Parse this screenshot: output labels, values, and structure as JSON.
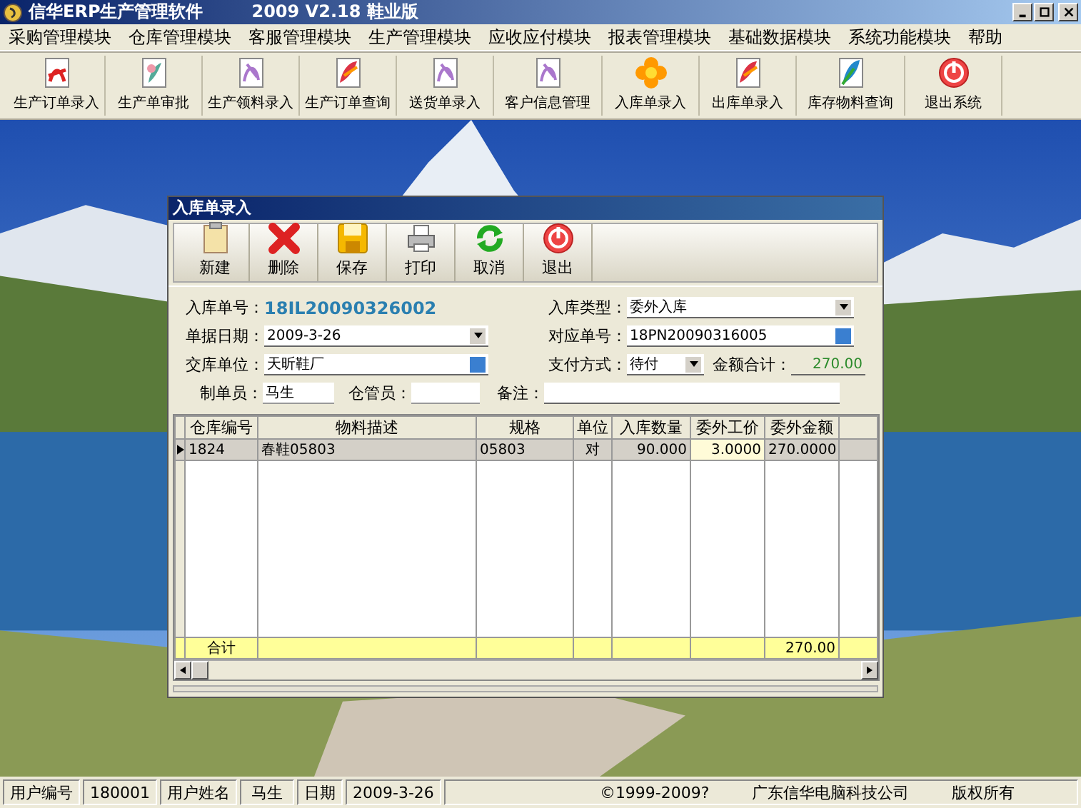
{
  "window": {
    "title": "信华ERP生产管理软件",
    "version": "2009 V2.18 鞋业版"
  },
  "menu": [
    "采购管理模块",
    "仓库管理模块",
    "客服管理模块",
    "生产管理模块",
    "应收应付模块",
    "报表管理模块",
    "基础数据模块",
    "系统功能模块",
    "帮助"
  ],
  "toolbar": [
    {
      "label": "生产订单录入"
    },
    {
      "label": "生产单审批"
    },
    {
      "label": "生产领料录入"
    },
    {
      "label": "生产订单查询"
    },
    {
      "label": "送货单录入"
    },
    {
      "label": "客户信息管理"
    },
    {
      "label": "入库单录入"
    },
    {
      "label": "出库单录入"
    },
    {
      "label": "库存物料查询"
    },
    {
      "label": "退出系统"
    }
  ],
  "dialog": {
    "title": "入库单录入",
    "toolbar": [
      {
        "label": "新建"
      },
      {
        "label": "删除"
      },
      {
        "label": "保存"
      },
      {
        "label": "打印"
      },
      {
        "label": "取消"
      },
      {
        "label": "退出"
      }
    ],
    "form_rows": [
      [
        {
          "label": "入库单号：",
          "value": "18IL20090326002",
          "kind": "code"
        },
        {
          "label": "入库类型：",
          "value": "委外入库",
          "kind": "dropdown"
        }
      ],
      [
        {
          "label": "单据日期：",
          "value": "2009-3-26",
          "kind": "dropdown"
        },
        {
          "label": "对应单号：",
          "value": "18PN20090316005",
          "kind": "lookup"
        }
      ],
      [
        {
          "label": "交库单位：",
          "value": "天昕鞋厂",
          "kind": "lookup"
        },
        {
          "label": "支付方式：",
          "value": "待付",
          "kind": "dropdown"
        },
        {
          "label": "金额合计：",
          "value": "270.00",
          "kind": "total"
        }
      ],
      [
        {
          "label": "制单员：",
          "value": "马生",
          "kind": "input"
        },
        {
          "label": "仓管员：",
          "kind": "input"
        },
        {
          "label": "备注：",
          "kind": "input"
        }
      ]
    ],
    "table": {
      "columns": [
        "仓库编号",
        "物料描述",
        "规格",
        "单位",
        "入库数量",
        "委外工价",
        "委外金额"
      ],
      "rows": [
        {
          "selected": true,
          "cells": [
            "1824",
            "春鞋05803",
            "05803",
            "对",
            "90.000",
            "3.0000",
            "270.0000"
          ]
        }
      ],
      "footer": {
        "label": "合计",
        "total": "270.00"
      }
    }
  },
  "status_bar": [
    {
      "label": "用户编号",
      "value": "180001"
    },
    {
      "label": "用户姓名",
      "value": "马生"
    },
    {
      "label": "日期",
      "value": "2009-3-26"
    }
  ],
  "copyright": [
    "©1999-2009?",
    "广东信华电脑科技公司",
    "版权所有"
  ]
}
